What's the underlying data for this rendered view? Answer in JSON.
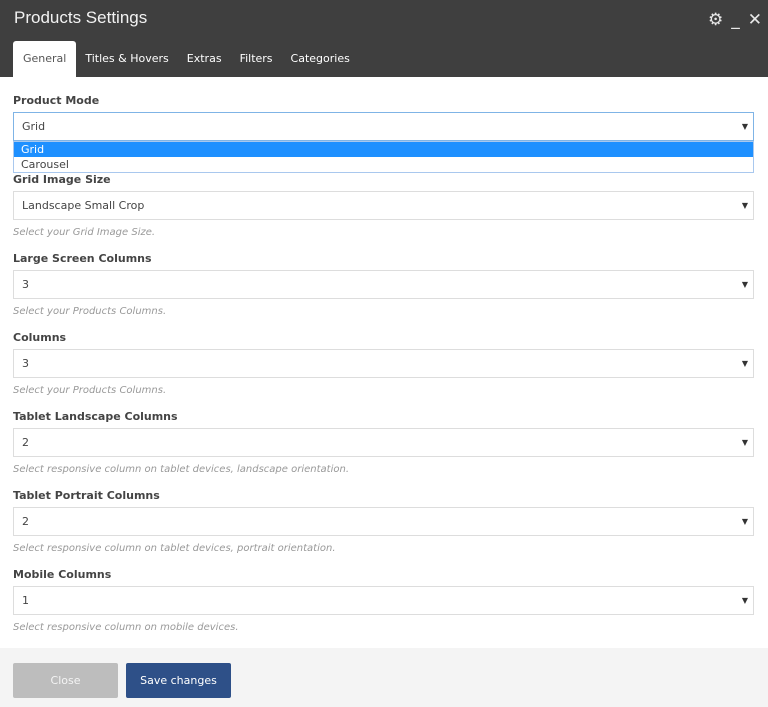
{
  "window": {
    "title": "Products Settings",
    "icons": [
      "gear-icon",
      "minimize-icon",
      "close-icon"
    ]
  },
  "tabs": [
    {
      "label": "General",
      "active": true
    },
    {
      "label": "Titles & Hovers"
    },
    {
      "label": "Extras"
    },
    {
      "label": "Filters"
    },
    {
      "label": "Categories"
    }
  ],
  "fields": [
    {
      "label": "Product Mode",
      "value": "Grid",
      "help": ""
    },
    {
      "label": "Grid Image Size",
      "value": "Landscape Small Crop",
      "help": "Select your Grid Image Size."
    },
    {
      "label": "Large Screen Columns",
      "value": "3",
      "help": "Select your Products Columns."
    },
    {
      "label": "Columns",
      "value": "3",
      "help": "Select your Products Columns."
    },
    {
      "label": "Tablet Landscape Columns",
      "value": "2",
      "help": "Select responsive column on tablet devices, landscape orientation."
    },
    {
      "label": "Tablet Portrait Columns",
      "value": "2",
      "help": "Select responsive column on tablet devices, portrait orientation."
    },
    {
      "label": "Mobile Columns",
      "value": "1",
      "help": "Select responsive column on mobile devices."
    }
  ],
  "dropdown": {
    "options": [
      "Grid",
      "Carousel"
    ],
    "selected": "Grid"
  },
  "footer": {
    "close_label": "Close",
    "save_label": "Save changes"
  },
  "colors": {
    "header": "#3f3f3f",
    "accent": "#2e5088",
    "highlight": "#1e90ff"
  }
}
